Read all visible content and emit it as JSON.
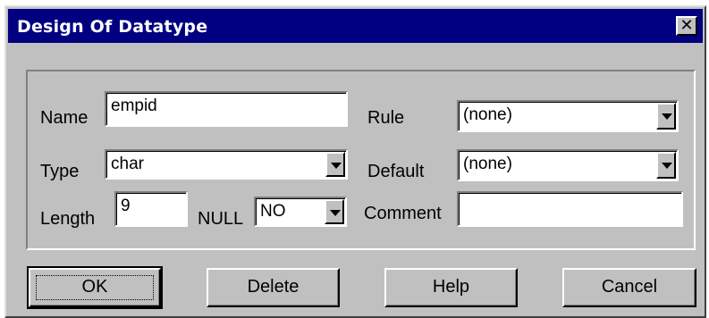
{
  "window": {
    "title": "Design Of Datatype",
    "close_glyph": "✕"
  },
  "form": {
    "name": {
      "label": "Name",
      "value": "empid"
    },
    "type": {
      "label": "Type",
      "value": "char"
    },
    "length": {
      "label": "Length",
      "value": "9"
    },
    "null": {
      "label": "NULL",
      "value": "NO"
    },
    "rule": {
      "label": "Rule",
      "value": "(none)"
    },
    "default": {
      "label": "Default",
      "value": "(none)"
    },
    "comment": {
      "label": "Comment",
      "value": ""
    }
  },
  "buttons": {
    "ok": "OK",
    "delete": "Delete",
    "help": "Help",
    "cancel": "Cancel"
  },
  "colors": {
    "titlebar": "#000080",
    "face": "#c0c0c0"
  },
  "icons": [
    "close-icon",
    "chevron-down-icon"
  ]
}
